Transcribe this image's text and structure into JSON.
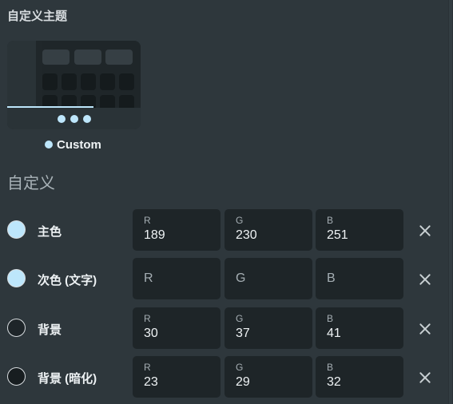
{
  "section_title": "自定义主题",
  "theme_card": {
    "label": "Custom",
    "accent": "#bde6fb"
  },
  "subsection_title": "自定义",
  "rows": [
    {
      "label": "主色",
      "swatch_color": "#bde6fb",
      "fields": [
        {
          "caption": "R",
          "value": "189"
        },
        {
          "caption": "G",
          "value": "230"
        },
        {
          "caption": "B",
          "value": "251"
        }
      ]
    },
    {
      "label": "次色 (文字)",
      "swatch_color": "#bde6fb",
      "fields": [
        {
          "placeholder": "R"
        },
        {
          "placeholder": "G"
        },
        {
          "placeholder": "B"
        }
      ]
    },
    {
      "label": "背景",
      "swatch_color": "#1e2529",
      "fields": [
        {
          "caption": "R",
          "value": "30"
        },
        {
          "caption": "G",
          "value": "37"
        },
        {
          "caption": "B",
          "value": "41"
        }
      ]
    },
    {
      "label": "背景 (暗化)",
      "swatch_color": "#171d20",
      "fields": [
        {
          "caption": "R",
          "value": "23"
        },
        {
          "caption": "G",
          "value": "29"
        },
        {
          "caption": "B",
          "value": "32"
        }
      ]
    }
  ],
  "icons": {
    "clear": "close-icon"
  }
}
